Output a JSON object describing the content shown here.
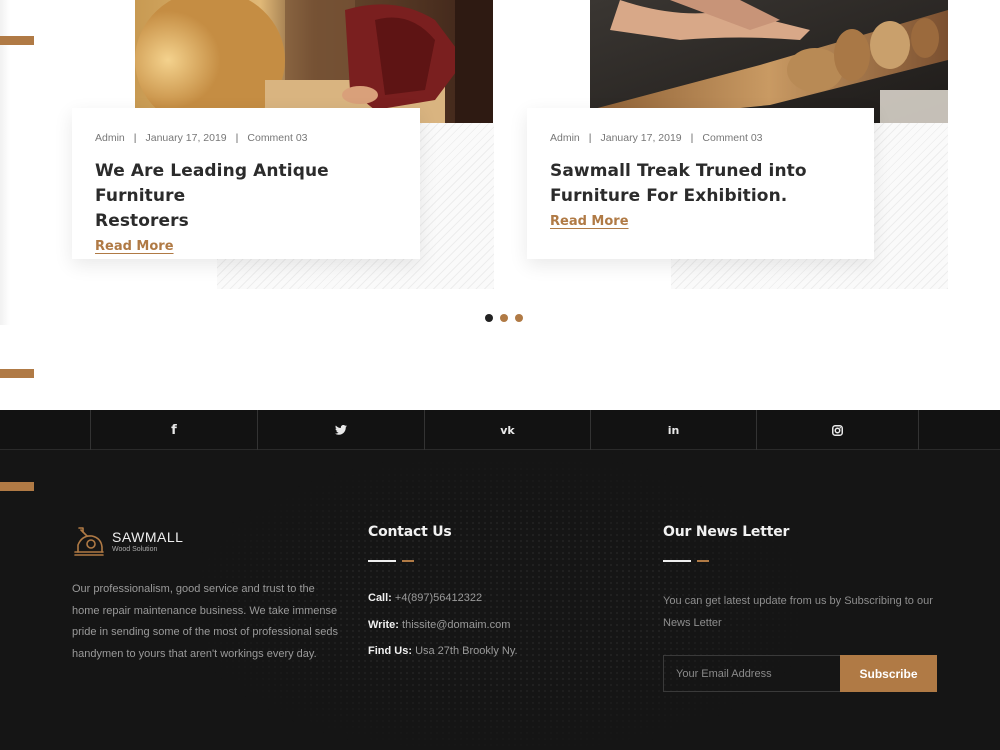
{
  "posts": [
    {
      "author": "Admin",
      "date": "January 17, 2019",
      "comments": "Comment 03",
      "title_line1": "We Are Leading Antique Furniture",
      "title_line2": "Restorers",
      "read_more": "Read More"
    },
    {
      "author": "Admin",
      "date": "January 17, 2019",
      "comments": "Comment 03",
      "title_line1": "Sawmall Treak Truned into",
      "title_line2": "Furniture For Exhibition.",
      "read_more": "Read More"
    }
  ],
  "carousel": {
    "pages": 3,
    "active_index": 0
  },
  "social": [
    {
      "icon": "facebook-icon",
      "glyph": "f"
    },
    {
      "icon": "twitter-icon",
      "glyph": "🐦"
    },
    {
      "icon": "vk-icon",
      "glyph": "vk"
    },
    {
      "icon": "linkedin-icon",
      "glyph": "in"
    },
    {
      "icon": "instagram-icon",
      "glyph": "◎"
    }
  ],
  "footer": {
    "brand_name": "SAWMALL",
    "brand_tagline": "Wood Solution",
    "about": "Our professionalism, good service and trust to the home repair maintenance business. We take immense pride in sending some of the most of professional seds handymen to yours that aren't workings every day.",
    "contact_title": "Contact Us",
    "call_label": "Call:",
    "call_value": "+4(897)56412322",
    "write_label": "Write:",
    "write_value": "thissite@domaim.com",
    "find_label": "Find Us:",
    "find_value": "Usa 27th Brookly Ny.",
    "newsletter_title": "Our News Letter",
    "newsletter_text": "You can get latest update from us by Subscribing to our News Letter",
    "email_placeholder": "Your Email Address",
    "subscribe_label": "Subscribe"
  },
  "colors": {
    "accent": "#b07a45",
    "footer_bg": "#151515",
    "social_bg": "#121212"
  }
}
